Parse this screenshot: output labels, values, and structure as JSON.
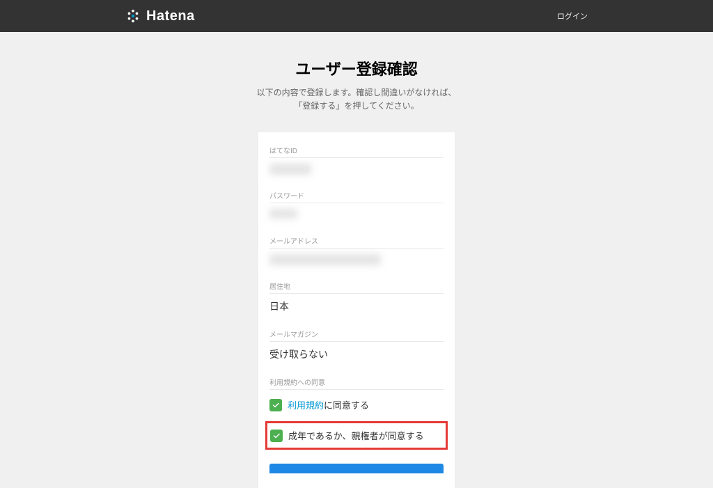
{
  "header": {
    "brand": "Hatena",
    "login_label": "ログイン"
  },
  "page": {
    "title": "ユーザー登録確認",
    "subtitle_line1": "以下の内容で登録します。確認し間違いがなければ、",
    "subtitle_line2": "「登録する」を押してください。"
  },
  "fields": {
    "hatena_id": {
      "label": "はてなID",
      "value": ""
    },
    "password": {
      "label": "パスワード",
      "value": ""
    },
    "email": {
      "label": "メールアドレス",
      "value": ""
    },
    "location": {
      "label": "居住地",
      "value": "日本"
    },
    "magazine": {
      "label": "メールマガジン",
      "value": "受け取らない"
    },
    "consent": {
      "label": "利用規約への同意",
      "tos_link": "利用規約",
      "tos_suffix": "に同意する",
      "adult_text": "成年であるか、親権者が同意する"
    }
  }
}
